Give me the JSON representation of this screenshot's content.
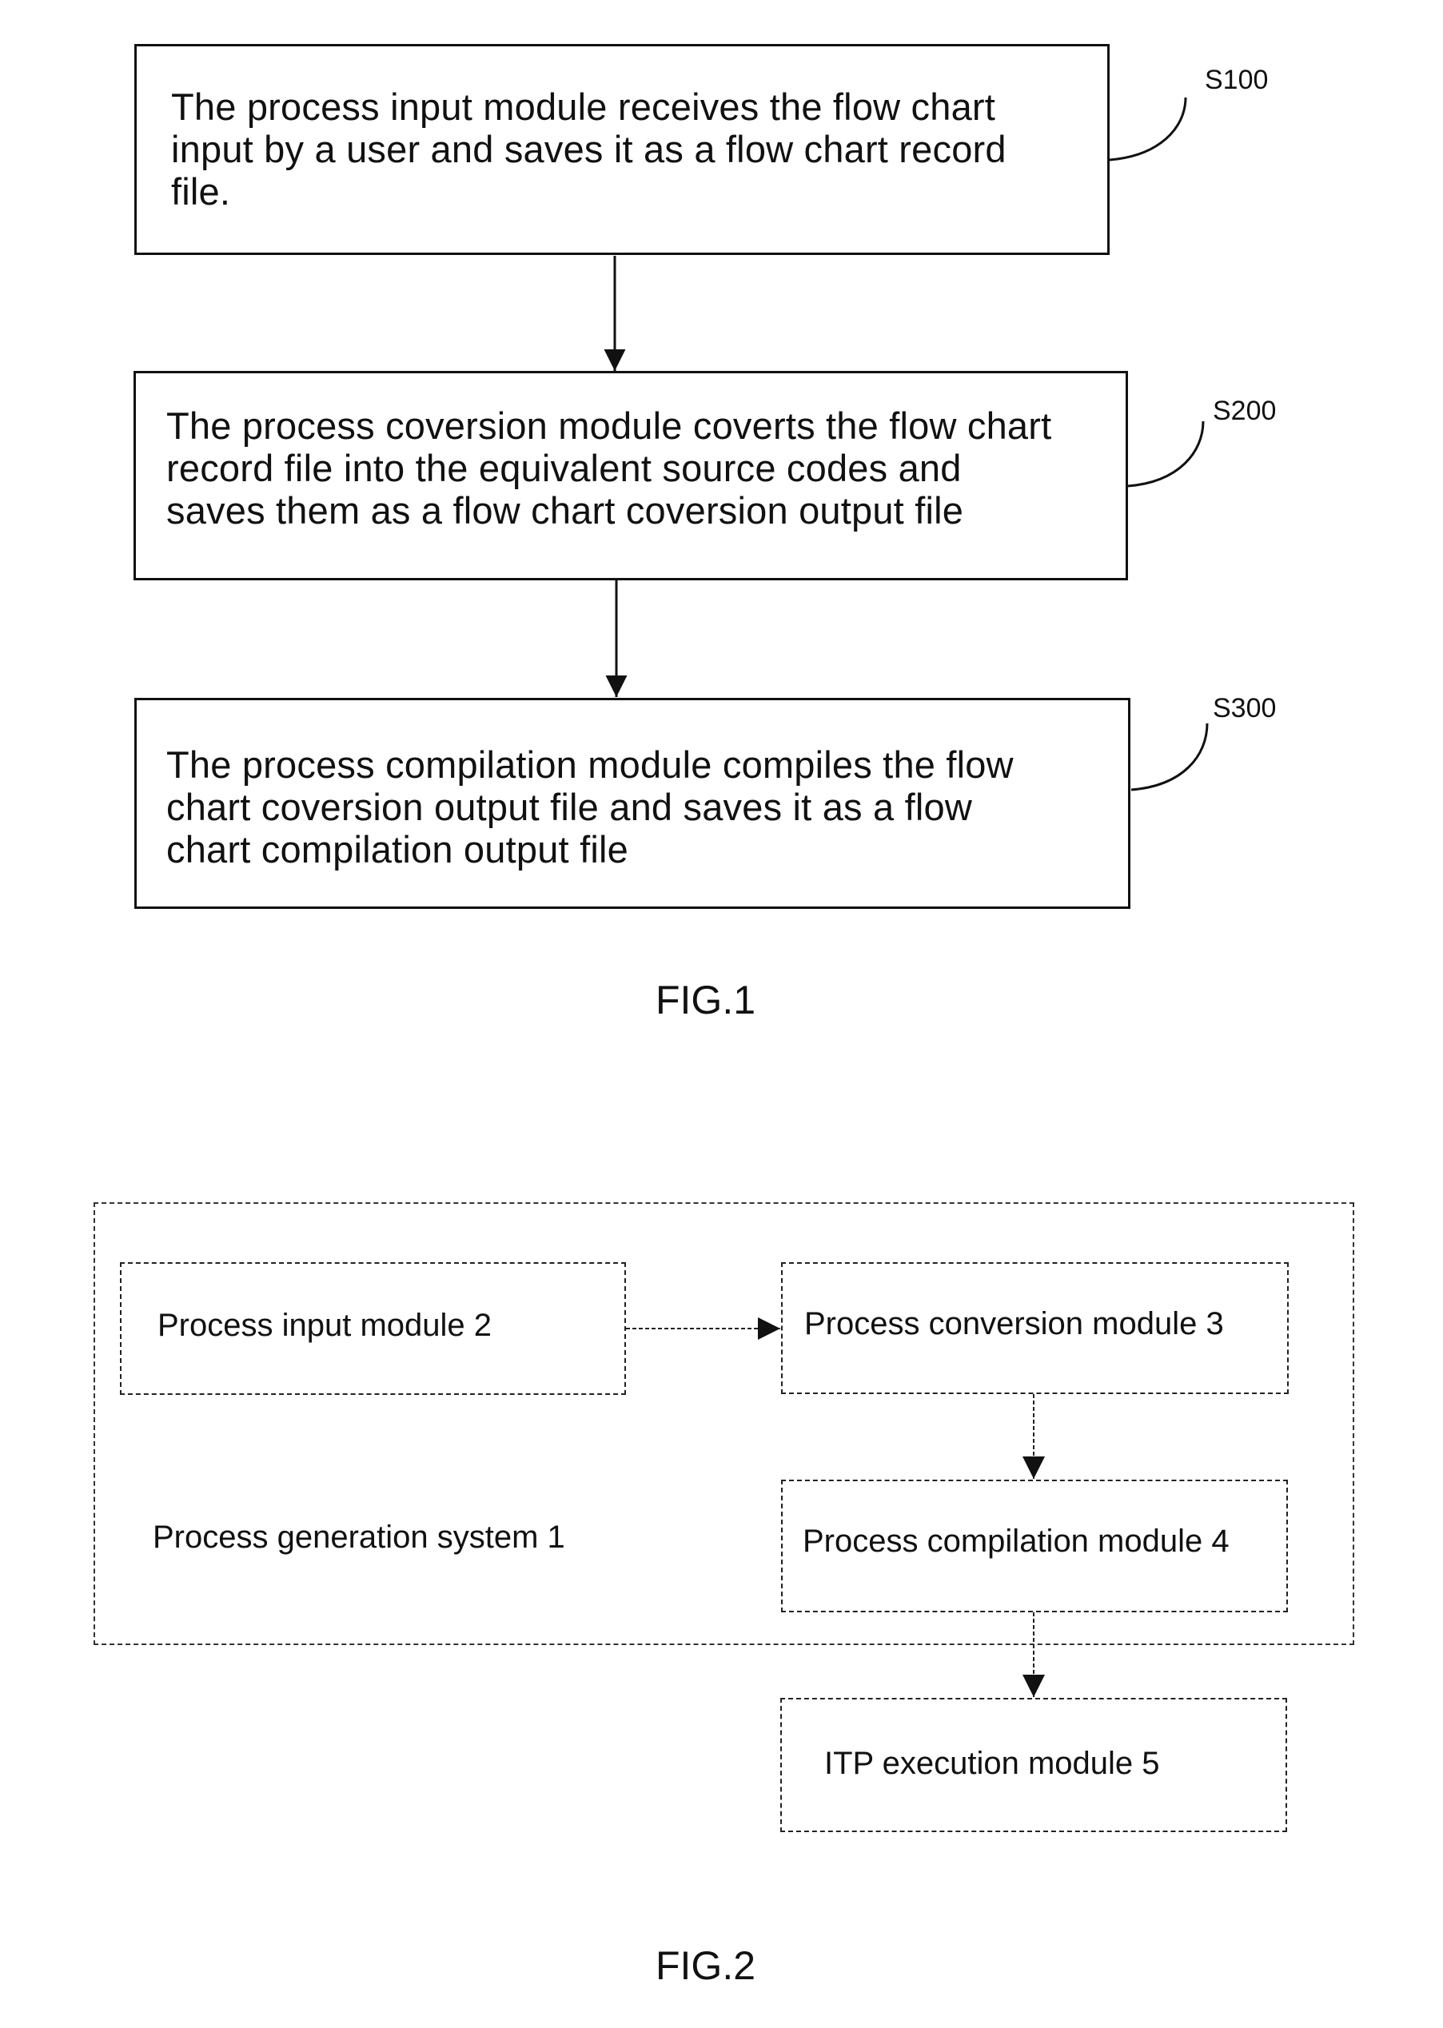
{
  "fig1": {
    "caption": "FIG.1",
    "steps": [
      {
        "ref": "S100",
        "lines": [
          "The process input module receives the flow chart",
          "input by a user and saves it as a flow chart record",
          "file."
        ]
      },
      {
        "ref": "S200",
        "lines": [
          "The process coversion module coverts the flow chart",
          "record file into the equivalent source codes and",
          "saves them as a flow chart coversion output file"
        ]
      },
      {
        "ref": "S300",
        "lines": [
          "The process compilation module compiles the flow",
          "chart coversion output file and saves it as a flow",
          "chart compilation output file"
        ]
      }
    ]
  },
  "fig2": {
    "caption": "FIG.2",
    "system_label": "Process generation system 1",
    "modules": {
      "input": "Process input module 2",
      "conversion": "Process conversion module 3",
      "compilation": "Process compilation module 4",
      "execution": "ITP execution module 5"
    }
  }
}
